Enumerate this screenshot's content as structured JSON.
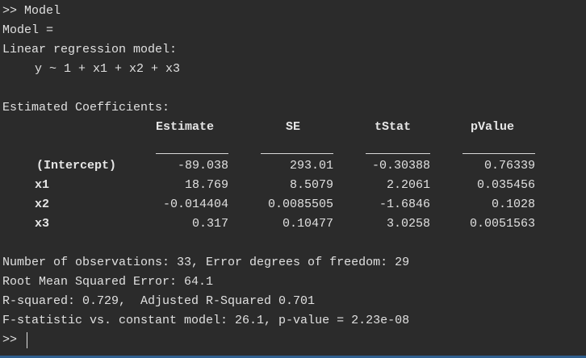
{
  "console": {
    "command": ">> Model",
    "assign": "Model =",
    "model_type": "Linear regression model:",
    "formula": "y ~ 1 + x1 + x2 + x3",
    "coef_title": "Estimated Coefficients:",
    "table": {
      "headers": [
        "Estimate",
        "SE",
        "tStat",
        "pValue"
      ],
      "rows": [
        {
          "label": "(Intercept)",
          "values": [
            "-89.038",
            "293.01",
            "-0.30388",
            "0.76339"
          ]
        },
        {
          "label": "x1",
          "values": [
            "18.769",
            "8.5079",
            "2.2061",
            "0.035456"
          ]
        },
        {
          "label": "x2",
          "values": [
            "-0.014404",
            "0.0085505",
            "-1.6846",
            "0.1028"
          ]
        },
        {
          "label": "x3",
          "values": [
            "0.317",
            "0.10477",
            "3.0258",
            "0.0051563"
          ]
        }
      ]
    },
    "stats": {
      "observations": "Number of observations: 33, Error degrees of freedom: 29",
      "rmse": "Root Mean Squared Error: 64.1",
      "rsquared": "R-squared: 0.729,  Adjusted R-Squared 0.701",
      "fstat": "F-statistic vs. constant model: 26.1, p-value = 2.23e-08"
    },
    "prompt": ">>"
  }
}
